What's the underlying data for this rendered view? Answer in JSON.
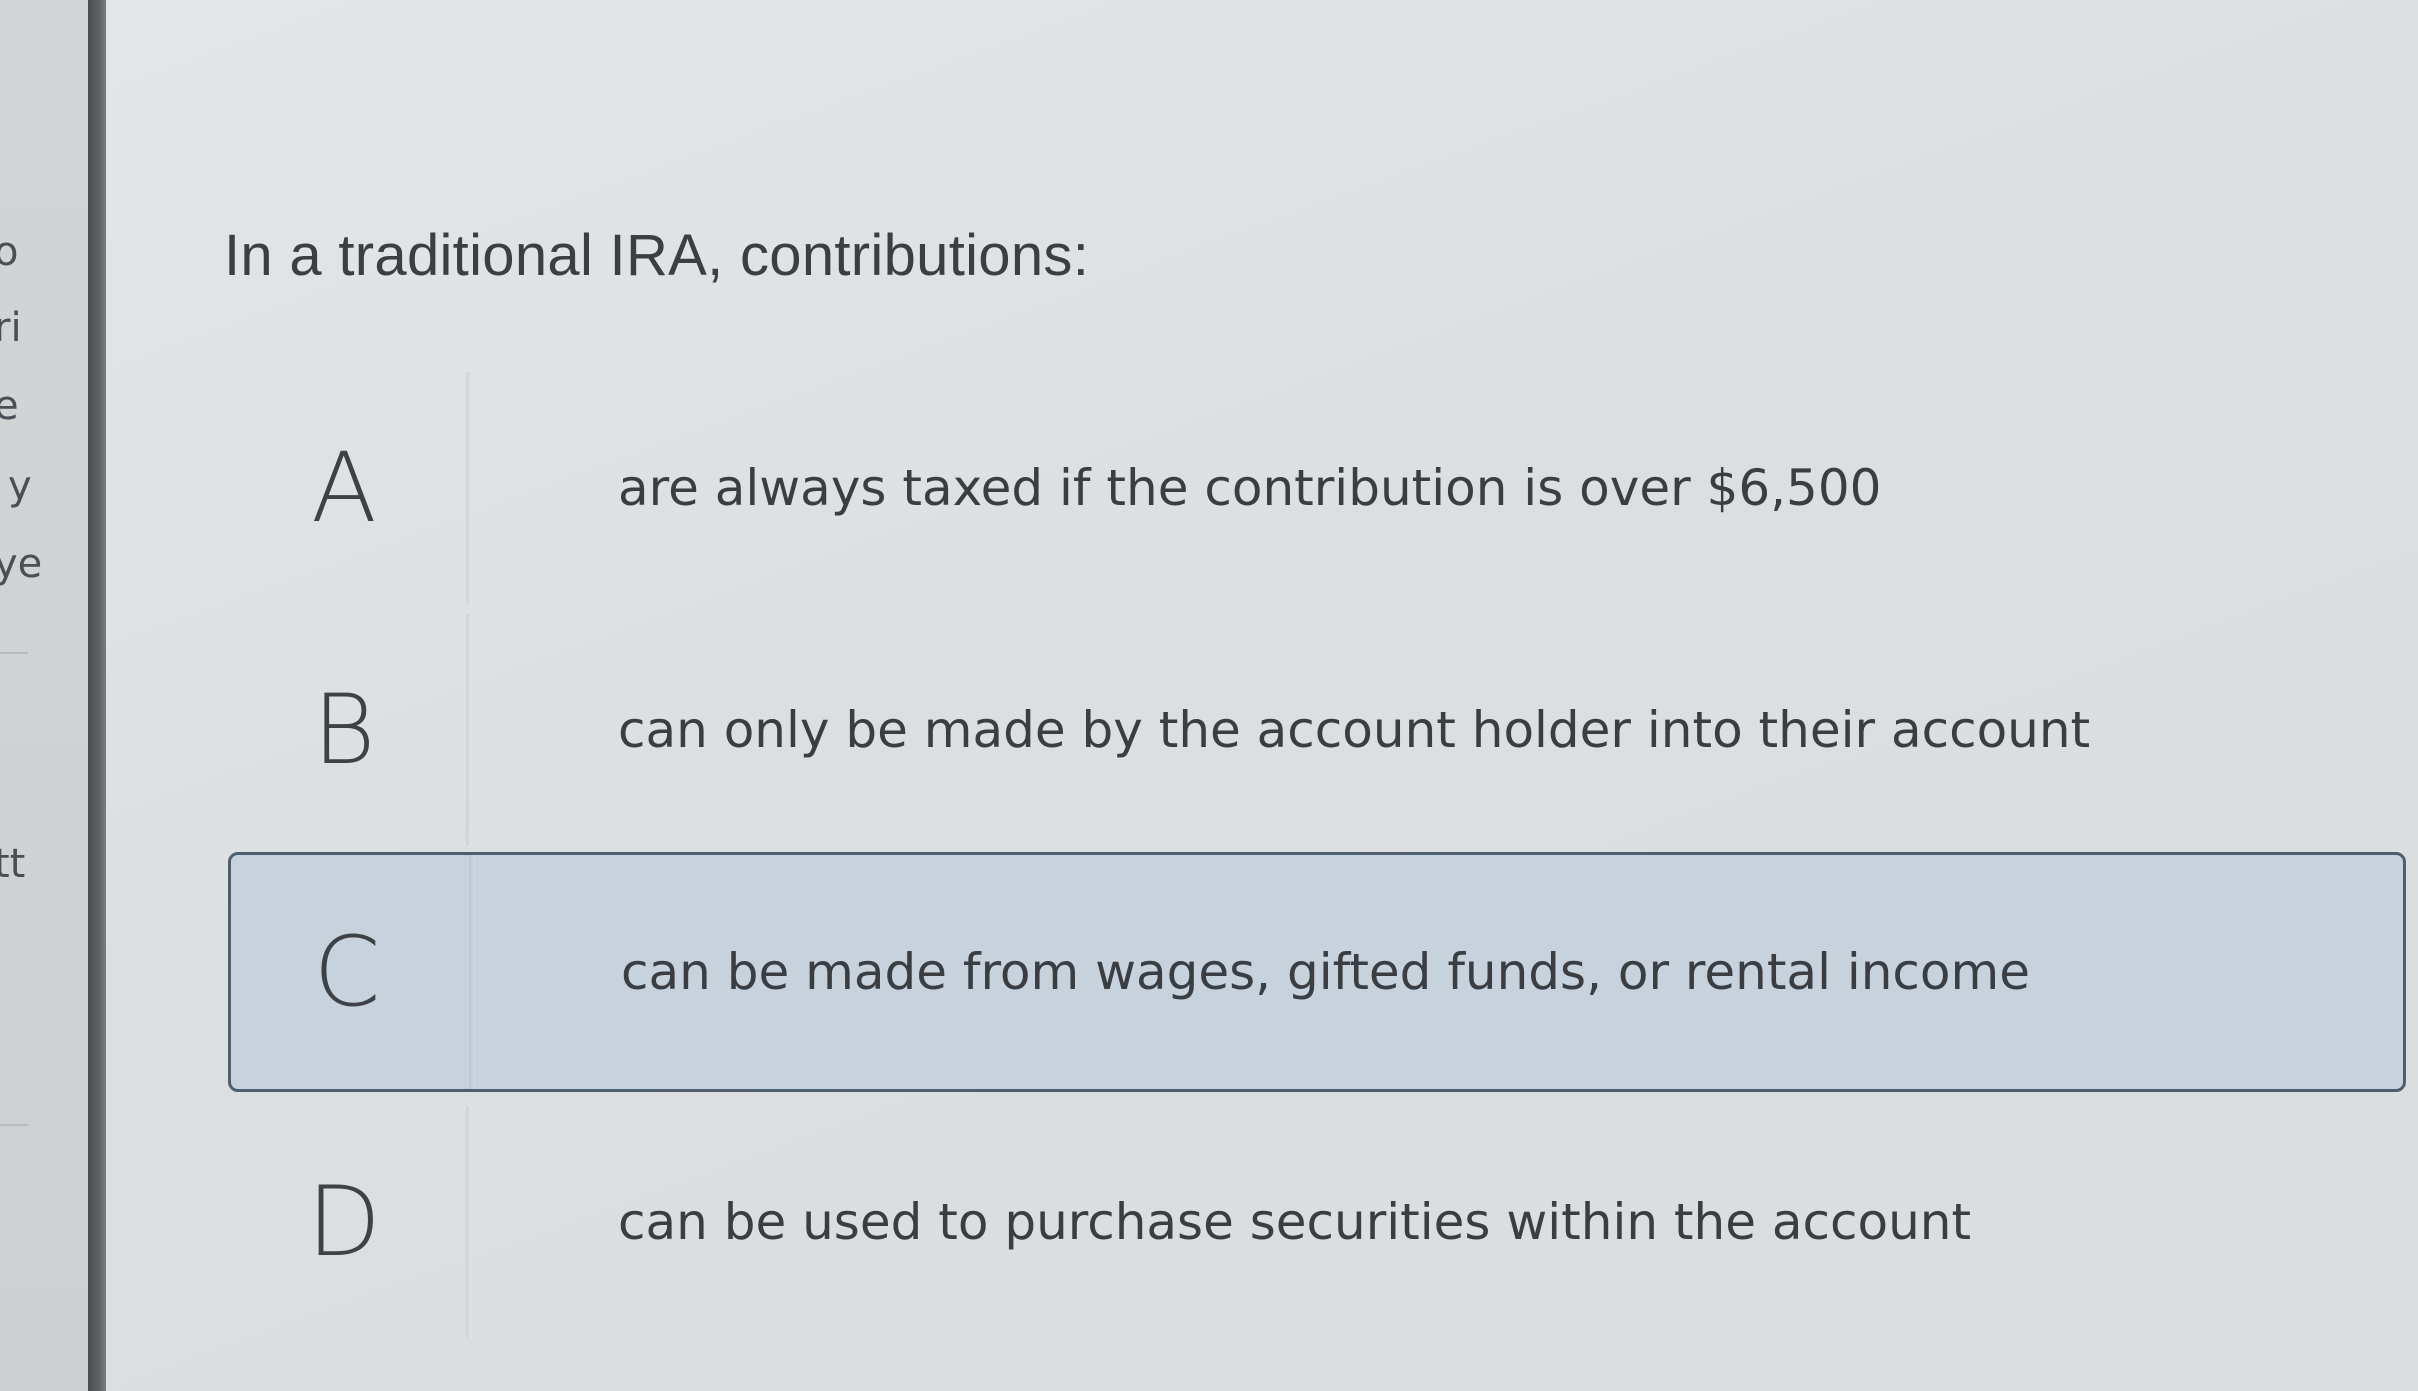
{
  "left_panel": {
    "fragments": [
      "o",
      "ri",
      "e",
      "y",
      "ye",
      "tt"
    ]
  },
  "question": {
    "text": "In a traditional IRA, contributions:"
  },
  "options": [
    {
      "letter": "A",
      "text": "are always taxed if the contribution is over $6,500",
      "selected": false
    },
    {
      "letter": "B",
      "text": "can only be made by the account holder into their account",
      "selected": false
    },
    {
      "letter": "C",
      "text": "can be made from wages, gifted funds, or rental income",
      "selected": true
    },
    {
      "letter": "D",
      "text": "can be used to purchase securities within the account",
      "selected": false
    }
  ],
  "colors": {
    "selected_background": "#c7d2dc",
    "selected_border": "#4e5d70",
    "text": "#3a3e43"
  }
}
